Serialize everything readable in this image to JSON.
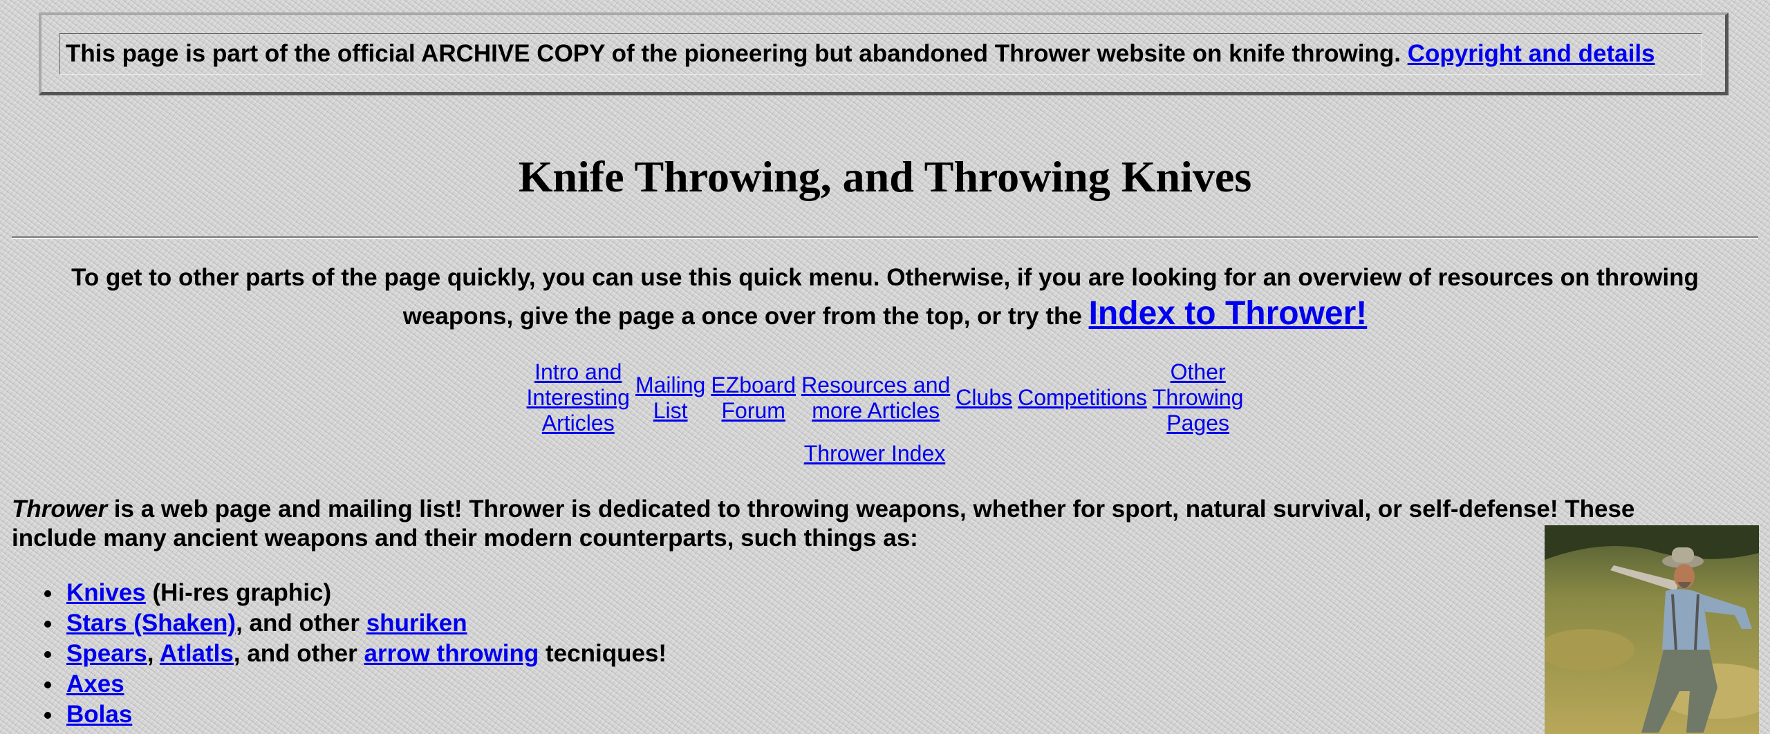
{
  "archive_banner": {
    "text": "This page is part of the official ARCHIVE COPY of the pioneering but abandoned Thrower website on knife throwing.",
    "link": "Copyright and details"
  },
  "page_title": "Knife Throwing, and Throwing Knives",
  "intro": {
    "text": "To get to other parts of the page quickly, you can use this quick menu. Otherwise, if you are looking for an overview of resources on throwing weapons, give the page a once over from the top, or try the",
    "link": "Index to Thrower!"
  },
  "quick_menu": {
    "items": [
      {
        "line1": "Intro and",
        "line2": "Interesting",
        "line3": "Articles"
      },
      {
        "line1": "Mailing",
        "line2": "List"
      },
      {
        "line1": "EZboard",
        "line2": "Forum"
      },
      {
        "line1": "Resources and",
        "line2": "more Articles"
      },
      {
        "line1": "Clubs"
      },
      {
        "line1": "Competitions"
      },
      {
        "line1": "Other",
        "line2": "Throwing",
        "line3": "Pages"
      }
    ],
    "index_link": "Thrower Index"
  },
  "description": {
    "italic_name": "Thrower",
    "text_1": " is a web page and mailing list! Thrower is dedicated to throwing weapons, whether for sport, natural survival, or self-defense! These include many ancient weapons and their modern counterparts, such things as:"
  },
  "weapons_list": [
    {
      "link_1": "Knives",
      "text_1": " (Hi-res graphic)"
    },
    {
      "link_1": "Stars (Shaken)",
      "text_1": ", and other ",
      "link_2": "shuriken"
    },
    {
      "link_1": "Spears",
      "text_1": ", ",
      "link_2": "Atlatls",
      "text_2": ", and other ",
      "link_3": "arrow throwing",
      "text_3": " tecniques!"
    },
    {
      "link_1": "Axes"
    },
    {
      "link_1": "Bolas"
    }
  ],
  "colors": {
    "link": "#0000ee",
    "background": "#d4d4d4",
    "text": "#000000"
  }
}
